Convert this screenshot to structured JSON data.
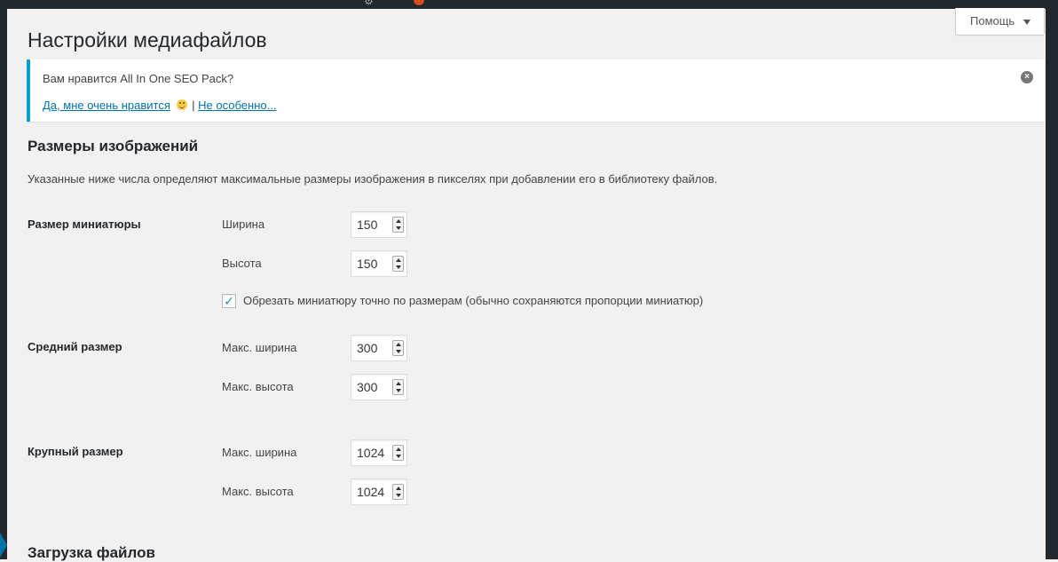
{
  "help": {
    "label": "Помощь"
  },
  "page": {
    "title": "Настройки медиафайлов"
  },
  "notice": {
    "question": "Вам нравится All In One SEO Pack?",
    "yes_link": "Да, мне очень нравится",
    "separator": "|",
    "no_link": "Не особенно...",
    "accent_color": "#00a0d2"
  },
  "images": {
    "heading": "Размеры изображений",
    "description": "Указанные ниже числа определяют максимальные размеры изображения в пикселях при добавлении его в библиотеку файлов.",
    "thumbnail": {
      "label": "Размер миниатюры",
      "width_label": "Ширина",
      "width_value": "150",
      "height_label": "Высота",
      "height_value": "150",
      "crop_checked": true,
      "crop_label": "Обрезать миниатюру точно по размерам (обычно сохраняются пропорции миниатюр)"
    },
    "medium": {
      "label": "Средний размер",
      "width_label": "Макс. ширина",
      "width_value": "300",
      "height_label": "Макс. высота",
      "height_value": "300"
    },
    "large": {
      "label": "Крупный размер",
      "width_label": "Макс. ширина",
      "width_value": "1024",
      "height_label": "Макс. высота",
      "height_value": "1024"
    }
  },
  "uploads": {
    "heading": "Загрузка файлов"
  },
  "icons": {
    "help_dropdown": "caret-down-icon",
    "dismiss": "dismiss-circle-icon",
    "smiley": "smiley-icon",
    "check": "checkmark-icon",
    "spinner": "spinner-arrows-icon"
  }
}
